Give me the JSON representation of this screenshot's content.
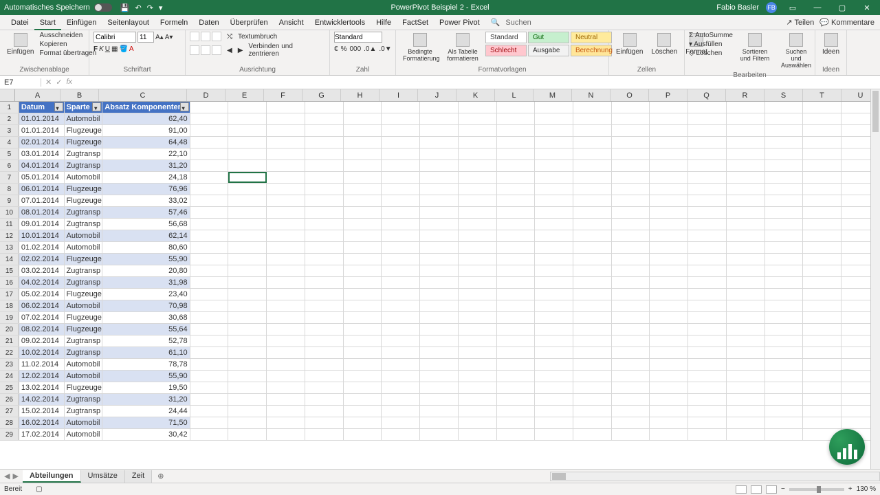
{
  "titlebar": {
    "autosave": "Automatisches Speichern",
    "doc_title": "PowerPivot Beispiel 2 - Excel",
    "user": "Fabio Basler"
  },
  "tabs": [
    "Datei",
    "Start",
    "Einfügen",
    "Seitenlayout",
    "Formeln",
    "Daten",
    "Überprüfen",
    "Ansicht",
    "Entwicklertools",
    "Hilfe",
    "FactSet",
    "Power Pivot"
  ],
  "search_placeholder": "Suchen",
  "share": "Teilen",
  "comments": "Kommentare",
  "ribbon": {
    "clipboard": {
      "cut": "Ausschneiden",
      "copy": "Kopieren",
      "paint": "Format übertragen",
      "paste": "Einfügen",
      "label": "Zwischenablage"
    },
    "font": {
      "name": "Calibri",
      "size": "11",
      "label": "Schriftart"
    },
    "align": {
      "wrap": "Textumbruch",
      "merge": "Verbinden und zentrieren",
      "label": "Ausrichtung"
    },
    "number": {
      "fmt": "Standard",
      "label": "Zahl"
    },
    "cond": {
      "cond": "Bedingte Formatierung",
      "astab": "Als Tabelle formatieren",
      "label": "Formatvorlagen"
    },
    "styles": {
      "std": "Standard",
      "gut": "Gut",
      "neutral": "Neutral",
      "schlecht": "Schlecht",
      "ausgabe": "Ausgabe",
      "berech": "Berechnung"
    },
    "cells": {
      "ins": "Einfügen",
      "del": "Löschen",
      "fmt": "Format",
      "label": "Zellen"
    },
    "edit": {
      "sum": "AutoSumme",
      "fill": "Ausfüllen",
      "clear": "Löschen",
      "sort": "Sortieren und Filtern",
      "find": "Suchen und Auswählen",
      "label": "Bearbeiten"
    },
    "ideas": {
      "label": "Ideen"
    }
  },
  "namebox": "E7",
  "columns": [
    "A",
    "B",
    "C",
    "D",
    "E",
    "F",
    "G",
    "H",
    "I",
    "J",
    "K",
    "L",
    "M",
    "N",
    "O",
    "P",
    "Q",
    "R",
    "S",
    "T",
    "U"
  ],
  "headers": {
    "A": "Datum",
    "B": "Sparte",
    "C": "Absatz Komponenten"
  },
  "rows": [
    {
      "n": 2,
      "A": "01.01.2014",
      "B": "Automobil",
      "C": "62,40"
    },
    {
      "n": 3,
      "A": "01.01.2014",
      "B": "Flugzeuge",
      "C": "91,00"
    },
    {
      "n": 4,
      "A": "02.01.2014",
      "B": "Flugzeuge",
      "C": "64,48"
    },
    {
      "n": 5,
      "A": "03.01.2014",
      "B": "Zugtransp",
      "C": "22,10"
    },
    {
      "n": 6,
      "A": "04.01.2014",
      "B": "Zugtransp",
      "C": "31,20"
    },
    {
      "n": 7,
      "A": "05.01.2014",
      "B": "Automobil",
      "C": "24,18"
    },
    {
      "n": 8,
      "A": "06.01.2014",
      "B": "Flugzeuge",
      "C": "76,96"
    },
    {
      "n": 9,
      "A": "07.01.2014",
      "B": "Flugzeuge",
      "C": "33,02"
    },
    {
      "n": 10,
      "A": "08.01.2014",
      "B": "Zugtransp",
      "C": "57,46"
    },
    {
      "n": 11,
      "A": "09.01.2014",
      "B": "Zugtransp",
      "C": "56,68"
    },
    {
      "n": 12,
      "A": "10.01.2014",
      "B": "Automobil",
      "C": "62,14"
    },
    {
      "n": 13,
      "A": "01.02.2014",
      "B": "Automobil",
      "C": "80,60"
    },
    {
      "n": 14,
      "A": "02.02.2014",
      "B": "Flugzeuge",
      "C": "55,90"
    },
    {
      "n": 15,
      "A": "03.02.2014",
      "B": "Zugtransp",
      "C": "20,80"
    },
    {
      "n": 16,
      "A": "04.02.2014",
      "B": "Zugtransp",
      "C": "31,98"
    },
    {
      "n": 17,
      "A": "05.02.2014",
      "B": "Flugzeuge",
      "C": "23,40"
    },
    {
      "n": 18,
      "A": "06.02.2014",
      "B": "Automobil",
      "C": "70,98"
    },
    {
      "n": 19,
      "A": "07.02.2014",
      "B": "Flugzeuge",
      "C": "30,68"
    },
    {
      "n": 20,
      "A": "08.02.2014",
      "B": "Flugzeuge",
      "C": "55,64"
    },
    {
      "n": 21,
      "A": "09.02.2014",
      "B": "Zugtransp",
      "C": "52,78"
    },
    {
      "n": 22,
      "A": "10.02.2014",
      "B": "Zugtransp",
      "C": "61,10"
    },
    {
      "n": 23,
      "A": "11.02.2014",
      "B": "Automobil",
      "C": "78,78"
    },
    {
      "n": 24,
      "A": "12.02.2014",
      "B": "Automobil",
      "C": "55,90"
    },
    {
      "n": 25,
      "A": "13.02.2014",
      "B": "Flugzeuge",
      "C": "19,50"
    },
    {
      "n": 26,
      "A": "14.02.2014",
      "B": "Zugtransp",
      "C": "31,20"
    },
    {
      "n": 27,
      "A": "15.02.2014",
      "B": "Zugtransp",
      "C": "24,44"
    },
    {
      "n": 28,
      "A": "16.02.2014",
      "B": "Automobil",
      "C": "71,50"
    },
    {
      "n": 29,
      "A": "17.02.2014",
      "B": "Automobil",
      "C": "30,42"
    }
  ],
  "sheets": [
    "Abteilungen",
    "Umsätze",
    "Zeit"
  ],
  "status": {
    "ready": "Bereit",
    "zoom": "130 %"
  }
}
